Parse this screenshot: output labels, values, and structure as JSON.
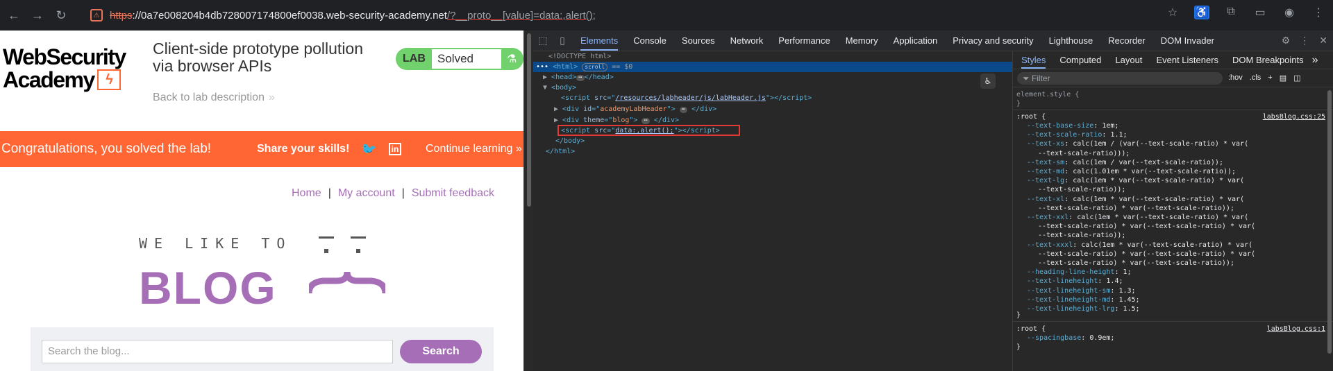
{
  "browser": {
    "url_scheme": "https",
    "url_host": "://0a7e008204b4db728007174800ef0038.web-security-academy.net",
    "url_path": "/?__proto__[value]=data:,alert();"
  },
  "page": {
    "logo_line1": "WebSecurity",
    "logo_line2": "Academy",
    "lab_title": "Client-side prototype pollution via browser APIs",
    "back_link": "Back to lab description",
    "lab_badge": "LAB",
    "lab_status": "Solved",
    "congrats": "Congratulations, you solved the lab!",
    "share": "Share your skills!",
    "continue": "Continue learning",
    "nav": {
      "home": "Home",
      "account": "My account",
      "feedback": "Submit feedback",
      "sep": "|"
    },
    "hero_top": "WE LIKE TO",
    "hero_main": "BLOG",
    "search_placeholder": "Search the blog...",
    "search_button": "Search"
  },
  "devtools": {
    "tabs": [
      "Elements",
      "Console",
      "Sources",
      "Network",
      "Performance",
      "Memory",
      "Application",
      "Privacy and security",
      "Lighthouse",
      "Recorder",
      "DOM Invader"
    ],
    "dom": {
      "doctype": "<!DOCTYPE html>",
      "html_open": "<html>",
      "scroll_pill": "scroll",
      "eq0": "== $0",
      "head": "<head>",
      "head_close": "</head>",
      "body": "<body>",
      "script1_src": "/resources/labheader/js/labHeader.js",
      "div_id": "academyLabHeader",
      "div_theme": "blog",
      "script2_src": "data:,alert();",
      "body_close": "</body>",
      "html_close": "</html>"
    },
    "styles_tabs": [
      "Styles",
      "Computed",
      "Layout",
      "Event Listeners",
      "DOM Breakpoints"
    ],
    "filter_placeholder": "Filter",
    "filter_tools": [
      ":hov",
      ".cls"
    ],
    "element_style": "element.style {",
    "root_source": "labsBlog.css:25",
    "root2_source": "labsBlog.css:1",
    "css_lines": [
      [
        "--text-base-size",
        "1em;"
      ],
      [
        "--text-scale-ratio",
        "1.1;"
      ],
      [
        "--text-xs",
        "calc(1em / (var(--text-scale-ratio) * var("
      ],
      [
        "",
        "--text-scale-ratio)));"
      ],
      [
        "--text-sm",
        "calc(1em / var(--text-scale-ratio));"
      ],
      [
        "--text-md",
        "calc(1.01em * var(--text-scale-ratio));"
      ],
      [
        "--text-lg",
        "calc(1em * var(--text-scale-ratio) * var("
      ],
      [
        "",
        "--text-scale-ratio));"
      ],
      [
        "--text-xl",
        "calc(1em * var(--text-scale-ratio) * var("
      ],
      [
        "",
        "--text-scale-ratio) * var(--text-scale-ratio));"
      ],
      [
        "--text-xxl",
        "calc(1em * var(--text-scale-ratio) * var("
      ],
      [
        "",
        "--text-scale-ratio) * var(--text-scale-ratio) * var("
      ],
      [
        "",
        "--text-scale-ratio));"
      ],
      [
        "--text-xxxl",
        "calc(1em * var(--text-scale-ratio) * var("
      ],
      [
        "",
        "--text-scale-ratio) * var(--text-scale-ratio) * var("
      ],
      [
        "",
        "--text-scale-ratio) * var(--text-scale-ratio));"
      ],
      [
        "--heading-line-height",
        "1;"
      ],
      [
        "--text-lineheight",
        "1.4;"
      ],
      [
        "--text-lineheight-sm",
        "1.3;"
      ],
      [
        "--text-lineheight-md",
        "1.45;"
      ],
      [
        "--text-lineheight-lrg",
        "1.5;"
      ]
    ],
    "spacing_line": [
      "--spacingbase",
      "0.9em;"
    ]
  }
}
